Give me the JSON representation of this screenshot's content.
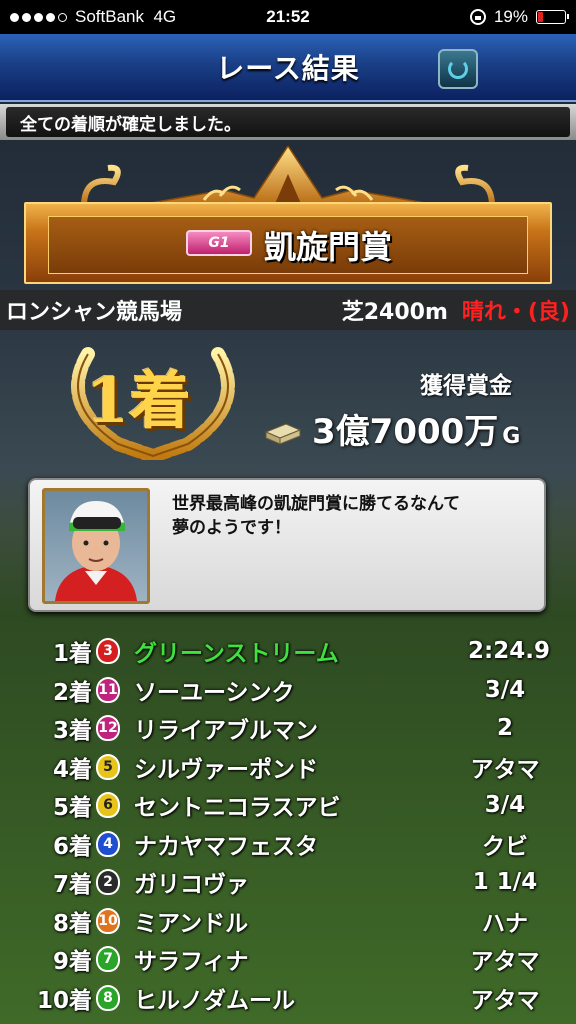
{
  "status_bar": {
    "carrier": "SoftBank",
    "network": "4G",
    "time": "21:52",
    "battery": "19%",
    "battery_level": 0.19,
    "signal_bars": 4
  },
  "header": {
    "title": "レース結果",
    "refresh_icon": "refresh-icon"
  },
  "notice": "全ての着順が確定しました。",
  "race": {
    "grade": "G1",
    "name": "凱旋門賞",
    "venue": "ロンシャン競馬場",
    "distance": "芝2400m",
    "weather": "晴れ・(良)"
  },
  "result": {
    "placing": "1着",
    "prize_label": "獲得賞金",
    "prize_amount": "3億7000万",
    "prize_unit": "G"
  },
  "comment": "世界最高峰の凱旋門賞に勝てるなんて\n夢のようです！",
  "colors": {
    "winner": "#3fe03f",
    "weather": "#ff2020"
  },
  "results": [
    {
      "rank": "1着",
      "number": "3",
      "badge_color": "#d61e1e",
      "name": "グリーンストリーム",
      "margin": "2:24.9"
    },
    {
      "rank": "2着",
      "number": "11",
      "badge_color": "#c0237e",
      "name": "ソーユーシンク",
      "margin": "3/4"
    },
    {
      "rank": "3着",
      "number": "12",
      "badge_color": "#c0237e",
      "name": "リライアブルマン",
      "margin": "2"
    },
    {
      "rank": "4着",
      "number": "5",
      "badge_color": "#e8c41a",
      "name": "シルヴァーポンド",
      "margin": "アタマ"
    },
    {
      "rank": "5着",
      "number": "6",
      "badge_color": "#e8c41a",
      "name": "セントニコラスアビ",
      "margin": "3/4"
    },
    {
      "rank": "6着",
      "number": "4",
      "badge_color": "#1f4fd0",
      "name": "ナカヤマフェスタ",
      "margin": "クビ"
    },
    {
      "rank": "7着",
      "number": "2",
      "badge_color": "#2a2a2a",
      "name": "ガリコヴァ",
      "margin": "1 1/4"
    },
    {
      "rank": "8着",
      "number": "10",
      "badge_color": "#e0731c",
      "name": "ミアンドル",
      "margin": "ハナ"
    },
    {
      "rank": "9着",
      "number": "7",
      "badge_color": "#2aa52a",
      "name": "サラフィナ",
      "margin": "アタマ"
    },
    {
      "rank": "10着",
      "number": "8",
      "badge_color": "#2aa52a",
      "name": "ヒルノダムール",
      "margin": "アタマ"
    }
  ]
}
